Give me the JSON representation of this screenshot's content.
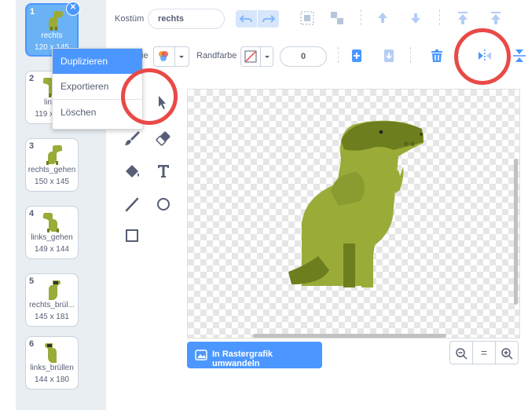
{
  "costumes": [
    {
      "num": "1",
      "name": "rechts",
      "size": "120 x 145"
    },
    {
      "num": "2",
      "name": "links",
      "size": "119 x 145"
    },
    {
      "num": "3",
      "name": "rechts_gehen",
      "size": "150 x 145"
    },
    {
      "num": "4",
      "name": "links_gehen",
      "size": "149 x 144"
    },
    {
      "num": "5",
      "name": "rechts_brül...",
      "size": "145 x 181"
    },
    {
      "num": "6",
      "name": "links_brüllen",
      "size": "144 x 180"
    }
  ],
  "context_menu": {
    "items": [
      "Duplizieren",
      "Exportieren",
      "Löschen"
    ]
  },
  "toolbar": {
    "costume_label": "Kostüm",
    "costume_name": "rechts",
    "fill_label": "ie",
    "outline_label": "Randfarbe",
    "outline_width": "0"
  },
  "canvas": {
    "convert_label": "In Rastergrafik umwandeln"
  },
  "zoom": {
    "out": "−",
    "reset": "=",
    "in": "+"
  },
  "colors": {
    "accent": "#4c97ff",
    "dino": "#9aab38",
    "dino_dark": "#6d7e1e",
    "annotation": "#e94a47"
  }
}
